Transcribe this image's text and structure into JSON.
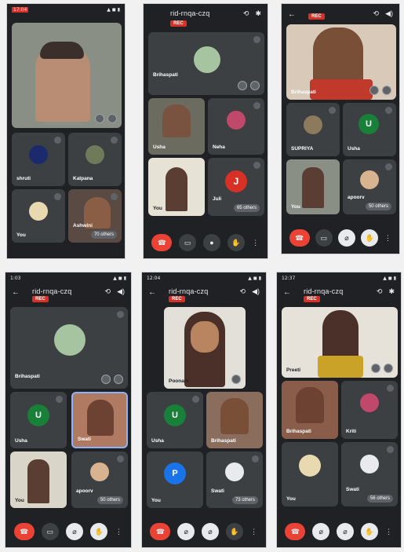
{
  "phones": [
    {
      "code": "",
      "status": "17:04",
      "tiles": [
        "",
        "shruti",
        "Kalpana",
        "You",
        "Ashwini",
        "70 others"
      ]
    },
    {
      "code": "rid-rnqa-czq",
      "rec": "REC",
      "tiles": [
        "Brihaspati",
        "Usha",
        "Neha",
        "You",
        "Juli",
        "65 others"
      ]
    },
    {
      "code": "",
      "rec": "REC",
      "tiles": [
        "Brihaspati",
        "SUPRIYA",
        "Usha",
        "You",
        "apoorv",
        "50 others"
      ]
    },
    {
      "code": "rid-rnqa-czq",
      "status": "1:03",
      "rec": "REC",
      "tiles": [
        "Brihaspati",
        "Usha",
        "Swati",
        "You",
        "apoorv",
        "50 others"
      ]
    },
    {
      "code": "rid-rnqa-czq",
      "status": "12:04",
      "rec": "REC",
      "tiles": [
        "Poonam",
        "Usha",
        "Brihaspati",
        "You",
        "Swati",
        "73 others"
      ]
    },
    {
      "code": "rid-rnqa-czq",
      "status": "12:37",
      "rec": "REC",
      "tiles": [
        "Preeti",
        "Brihaspati",
        "Kriti",
        "You",
        "Swati",
        "56 others"
      ]
    }
  ],
  "letters": {
    "u": "U",
    "j": "J",
    "p": "P"
  }
}
